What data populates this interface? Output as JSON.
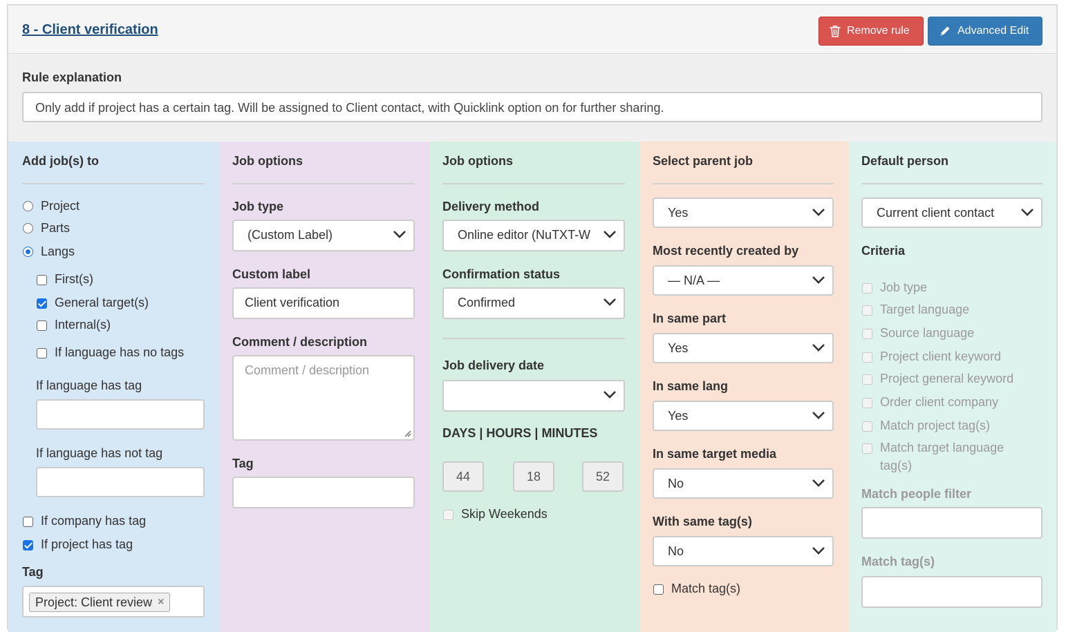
{
  "header": {
    "title": "8 - Client verification",
    "remove_label": "Remove rule",
    "advanced_label": "Advanced Edit"
  },
  "explanation": {
    "label": "Rule explanation",
    "value": "Only add if project has a certain tag. Will be assigned to Client contact, with Quicklink option on for further sharing."
  },
  "col1": {
    "heading": "Add job(s) to",
    "radios": [
      {
        "label": "Project",
        "checked": false
      },
      {
        "label": "Parts",
        "checked": false
      },
      {
        "label": "Langs",
        "checked": true
      }
    ],
    "lang_checks": [
      {
        "label": "First(s)",
        "checked": false
      },
      {
        "label": "General target(s)",
        "checked": true
      },
      {
        "label": "Internal(s)",
        "checked": false
      },
      {
        "label": "If language has no tags",
        "checked": false
      }
    ],
    "has_tag_label": "If language has tag",
    "has_not_tag_label": "If language has not tag",
    "company_tag": {
      "label": "If company has tag",
      "checked": false
    },
    "project_tag": {
      "label": "If project has tag",
      "checked": true
    },
    "tag_label": "Tag",
    "tag_chip": "Project: Client review",
    "tag_remove": "×"
  },
  "col2": {
    "heading": "Job options",
    "job_type_label": "Job type",
    "job_type_value": "(Custom Label)",
    "custom_label_label": "Custom label",
    "custom_label_value": "Client verification",
    "comment_label": "Comment / description",
    "comment_placeholder": "Comment / description",
    "tag_label": "Tag"
  },
  "col3": {
    "heading": "Job options",
    "delivery_label": "Delivery method",
    "delivery_value": "Online editor (NuTXT-W",
    "confirm_label": "Confirmation status",
    "confirm_value": "Confirmed",
    "date_label": "Job delivery date",
    "date_value": "",
    "dhm_label": "DAYS | HOURS | MINUTES",
    "days": "44",
    "hours": "18",
    "minutes": "52",
    "skip_weekends": "Skip Weekends"
  },
  "col4": {
    "heading": "Select parent job",
    "parent_value": "Yes",
    "recent_label": "Most recently created by",
    "recent_value": "— N/A —",
    "same_part_label": "In same part",
    "same_part_value": "Yes",
    "same_lang_label": "In same lang",
    "same_lang_value": "Yes",
    "same_media_label": "In same target media",
    "same_media_value": "No",
    "same_tags_label": "With same tag(s)",
    "same_tags_value": "No",
    "match_tags": "Match tag(s)"
  },
  "col5": {
    "heading": "Default person",
    "person_value": "Current client contact",
    "criteria_label": "Criteria",
    "criteria": [
      "Job type",
      "Target language",
      "Source language",
      "Project client keyword",
      "Project general keyword",
      "Order client company",
      "Match project tag(s)",
      "Match target language"
    ],
    "criteria_wrap": "tag(s)",
    "people_filter_label": "Match people filter",
    "match_tags_label": "Match tag(s)"
  },
  "colors": {
    "col1": "#d6e7f5",
    "col2": "#ebdfef",
    "col3": "#d5f0e2",
    "col4": "#fae3d5",
    "col5": "#dff3ee",
    "danger": "#d9534f",
    "primary": "#337ab7",
    "title": "#1f4f7a"
  }
}
